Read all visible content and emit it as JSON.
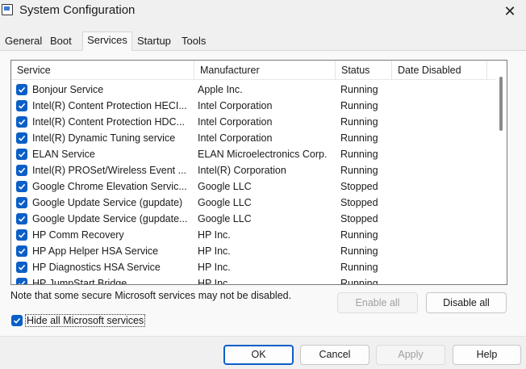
{
  "window": {
    "title": "System Configuration"
  },
  "tabs": [
    "General",
    "Boot",
    "Services",
    "Startup",
    "Tools"
  ],
  "active_tab": "Services",
  "columns": {
    "service": "Service",
    "manufacturer": "Manufacturer",
    "status": "Status",
    "date_disabled": "Date Disabled"
  },
  "services": [
    {
      "name": "Bonjour Service",
      "manufacturer": "Apple Inc.",
      "status": "Running",
      "checked": true
    },
    {
      "name": "Intel(R) Content Protection HECI...",
      "manufacturer": "Intel Corporation",
      "status": "Running",
      "checked": true
    },
    {
      "name": "Intel(R) Content Protection HDC...",
      "manufacturer": "Intel Corporation",
      "status": "Running",
      "checked": true
    },
    {
      "name": "Intel(R) Dynamic Tuning service",
      "manufacturer": "Intel Corporation",
      "status": "Running",
      "checked": true
    },
    {
      "name": "ELAN Service",
      "manufacturer": "ELAN Microelectronics Corp.",
      "status": "Running",
      "checked": true
    },
    {
      "name": "Intel(R) PROSet/Wireless Event ...",
      "manufacturer": "Intel(R) Corporation",
      "status": "Running",
      "checked": true
    },
    {
      "name": "Google Chrome Elevation Servic...",
      "manufacturer": "Google LLC",
      "status": "Stopped",
      "checked": true
    },
    {
      "name": "Google Update Service (gupdate)",
      "manufacturer": "Google LLC",
      "status": "Stopped",
      "checked": true
    },
    {
      "name": "Google Update Service (gupdate...",
      "manufacturer": "Google LLC",
      "status": "Stopped",
      "checked": true
    },
    {
      "name": "HP Comm Recovery",
      "manufacturer": "HP Inc.",
      "status": "Running",
      "checked": true
    },
    {
      "name": "HP App Helper HSA Service",
      "manufacturer": "HP Inc.",
      "status": "Running",
      "checked": true
    },
    {
      "name": "HP Diagnostics HSA Service",
      "manufacturer": "HP Inc.",
      "status": "Running",
      "checked": true
    },
    {
      "name": "HP JumpStart Bridge",
      "manufacturer": "HP Inc.",
      "status": "Running",
      "checked": true
    }
  ],
  "note": "Note that some secure Microsoft services may not be disabled.",
  "buttons": {
    "enable_all": "Enable all",
    "disable_all": "Disable all",
    "ok": "OK",
    "cancel": "Cancel",
    "apply": "Apply",
    "help": "Help"
  },
  "hide_microsoft": {
    "label": "Hide all Microsoft services",
    "checked": true
  },
  "colors": {
    "accent": "#0a5fc7"
  }
}
